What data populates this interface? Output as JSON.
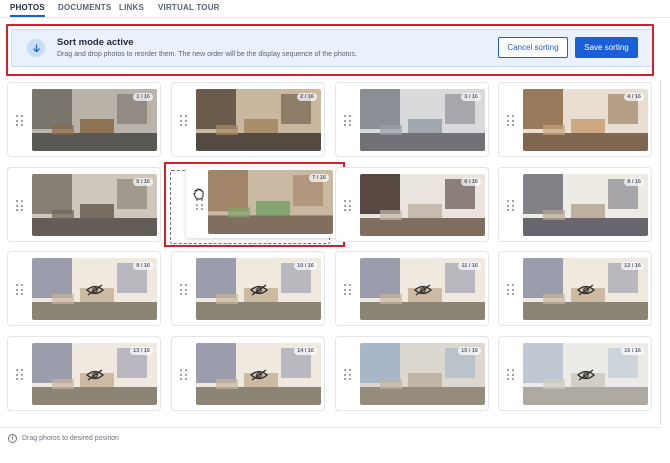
{
  "tabs": [
    {
      "label": "PHOTOS",
      "active": true
    },
    {
      "label": "DOCUMENTS",
      "active": false
    },
    {
      "label": "LINKS",
      "active": false
    },
    {
      "label": "VIRTUAL TOUR",
      "active": false
    }
  ],
  "banner": {
    "icon": "arrow-down-icon",
    "title": "Sort mode active",
    "description": "Drag and drop photos to reorder them. The new order will be the display sequence of the photos.",
    "cancel_label": "Cancel sorting",
    "save_label": "Save sorting"
  },
  "photos": [
    {
      "badge": "1 / 16",
      "hidden": false
    },
    {
      "badge": "2 / 16",
      "hidden": false
    },
    {
      "badge": "3 / 16",
      "hidden": false
    },
    {
      "badge": "4 / 16",
      "hidden": false
    },
    {
      "badge": "5 / 16",
      "hidden": false
    },
    {
      "badge": "7 / 16",
      "hidden": false,
      "dragging": true
    },
    {
      "badge": "6 / 16",
      "hidden": false
    },
    {
      "badge": "8 / 16",
      "hidden": false
    },
    {
      "badge": "9 / 16",
      "hidden": true
    },
    {
      "badge": "10 / 16",
      "hidden": true
    },
    {
      "badge": "11 / 16",
      "hidden": true
    },
    {
      "badge": "12 / 16",
      "hidden": true
    },
    {
      "badge": "13 / 16",
      "hidden": true
    },
    {
      "badge": "14 / 16",
      "hidden": true
    },
    {
      "badge": "15 / 16",
      "hidden": false
    },
    {
      "badge": "16 / 16",
      "hidden": true
    }
  ],
  "footer": {
    "text": "Drag photos to desired position"
  },
  "colors": {
    "accent": "#1a5fd6",
    "highlight": "#d51f2c",
    "banner_bg": "#e8f1fc"
  }
}
